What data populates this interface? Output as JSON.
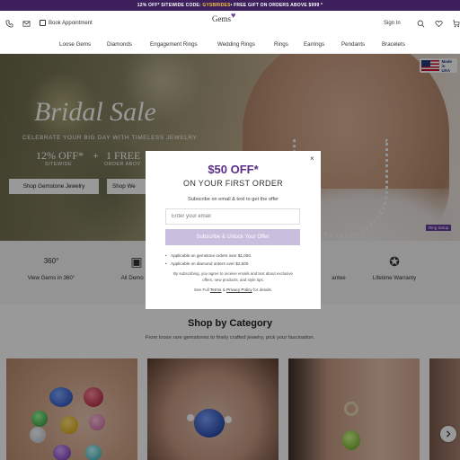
{
  "promo": {
    "part1": "12% OFF* SITEWIDE CODE:",
    "code": "GYSBRIDES",
    "part2": " • FREE GIFT ON ORDERS ABOVE $999 *"
  },
  "header": {
    "book_label": "Book Appointment",
    "logo": "Gems",
    "logo_mark": "♥",
    "signin_label": "Sign In",
    "icons": [
      "phone-icon",
      "mail-icon",
      "calendar-icon",
      "search-icon",
      "heart-icon",
      "cart-icon"
    ]
  },
  "nav": {
    "items": [
      "Loose Gems",
      "Diamonds",
      "Engagement Rings",
      "Wedding Rings",
      "Rings",
      "Earrings",
      "Pendants",
      "Bracelets"
    ]
  },
  "hero": {
    "title": "Bridal Sale",
    "subtitle": "CELEBRATE YOUR BIG DAY WITH TIMELESS JEWELRY",
    "offer1": "12% OFF*",
    "offer1_sub": "SITEWIDE",
    "plus": "+",
    "offer2": "1 FREE",
    "offer2_sub": "ORDER ABOV",
    "button1": "Shop Gemstone Jewelry",
    "button2": "Shop We",
    "flag_text1": "Made in",
    "flag_text2": "USA",
    "tag": "Ring Setup"
  },
  "features": [
    {
      "icon": "360-icon",
      "glyph": "360°",
      "label": "View Gems in 360°"
    },
    {
      "icon": "certificate-icon",
      "glyph": "▣",
      "label": "All Demo Ce"
    },
    {
      "icon": "guarantee-icon",
      "glyph": "",
      "label": "antee"
    },
    {
      "icon": "warranty-icon",
      "glyph": "✪",
      "label": "Lifetime Warranty"
    }
  ],
  "category": {
    "title": "Shop by Category",
    "subtitle": "From loose rare gemstones to finely crafted jewelry, pick your fascination."
  },
  "modal": {
    "headline": "$50 OFF*",
    "subheadline": "ON YOUR FIRST ORDER",
    "description": "Subscribe on email & text to get the offer",
    "email_placeholder": "Enter your email",
    "cta": "Subscribe & Unlock Your Offer",
    "bullet1": "Applicable on gemstone orders over $1,000.",
    "bullet2": "Applicable on diamond orders over $2,500.",
    "legal": "By subscribing, you agree to receive emails and text about exclusive offers, new products, and style tips.",
    "terms_prefix": "See Full ",
    "terms_link": "Terms",
    "terms_and": " & ",
    "privacy_link": "Privacy Policy",
    "terms_suffix": " for details.",
    "close_glyph": "×"
  },
  "colors": {
    "promo_bg": "#3d1f5c",
    "accent": "#5b2d86",
    "cta_bg": "#c9bedd"
  }
}
